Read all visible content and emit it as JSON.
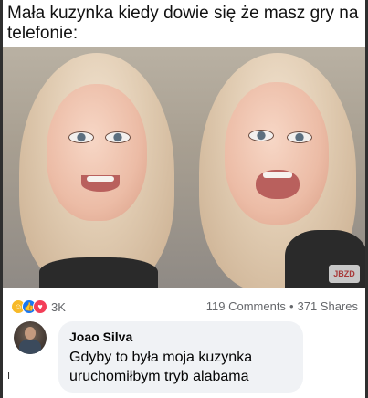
{
  "caption": "Mała kuzynka kiedy dowie się że masz gry na telefonie:",
  "watermark": "JBZD",
  "stats": {
    "reaction_count": "3K",
    "comments": "119 Comments",
    "separator": "•",
    "shares": "371 Shares",
    "reaction_icons": [
      "haha-icon",
      "like-icon",
      "love-icon"
    ]
  },
  "comment": {
    "author": "Joao Silva",
    "text_line1": "Gdyby to była moja kuzynka",
    "text_line2": "uruchomiłbym tryb alabama"
  },
  "colors": {
    "like": "#1877f2",
    "love": "#f33e58",
    "haha": "#f7b928",
    "bubble": "#f0f2f5",
    "meta_text": "#65676b"
  }
}
